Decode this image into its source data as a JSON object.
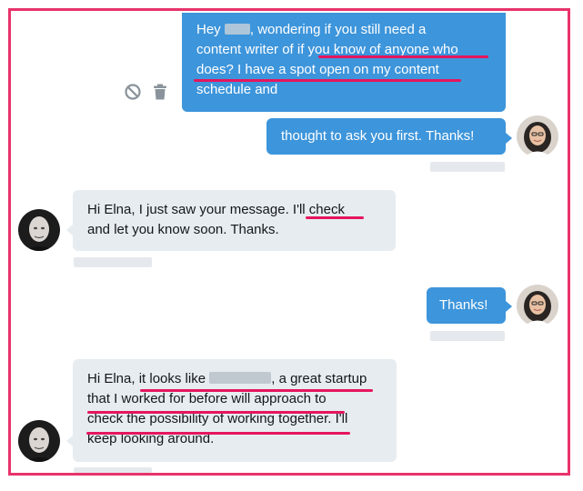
{
  "conversation": {
    "messages": [
      {
        "direction": "outgoing",
        "line1_a": "Hey",
        "line1_b": ", wondering if you still need a",
        "line2": "content writer of if you know of anyone who",
        "line3": "does? I have a spot open on my content",
        "line4": "schedule and"
      },
      {
        "direction": "outgoing",
        "text": "thought to ask you first. Thanks!"
      },
      {
        "direction": "incoming",
        "line1": "Hi Elna, I just saw your message. I'll check",
        "line2": "and let you know soon. Thanks."
      },
      {
        "direction": "outgoing",
        "text": "Thanks!"
      },
      {
        "direction": "incoming",
        "line1_a": "Hi Elna, it looks like",
        "line1_b": ", a great startup",
        "line2": "that I worked for before will approach to",
        "line3": "check the possibility of working together. I'll",
        "line4": "keep looking around."
      }
    ]
  },
  "icons": {
    "block": "block-icon",
    "trash": "trash-icon"
  },
  "colors": {
    "outgoing_bubble": "#3d95db",
    "incoming_bubble": "#e6ecf0",
    "highlight_underline": "#e5165e",
    "frame_border": "#e8336b"
  }
}
